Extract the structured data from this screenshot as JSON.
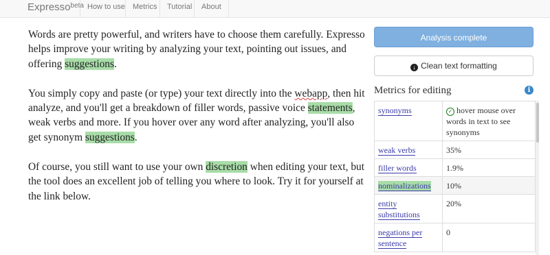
{
  "app": {
    "brand": "Expresso",
    "brand_sup": "beta"
  },
  "nav": {
    "items": [
      "How to use",
      "Metrics",
      "Tutorial",
      "About"
    ]
  },
  "content": {
    "p1": {
      "before": "Words are pretty powerful, and writers have to choose them carefully. Expresso helps improve your writing by analyzing your text, pointing out issues, and offering ",
      "hl": "suggestions",
      "after": "."
    },
    "p2": {
      "a": "You simply copy and paste (or type) your text directly into the ",
      "webapp": "webapp",
      "b": ", then hit analyze, and you'll get a breakdown of filler words, passive voice ",
      "hl1": "statements",
      "c": ", weak verbs and more. If you hover over any word after analyzing, you'll also get synonym ",
      "hl2": "suggestions",
      "d": "."
    },
    "p3": {
      "a": "Of course, you still want to use your own ",
      "hl": "discretion",
      "b": " when editing your text, but the tool does an excellent job of telling you where to look. Try it for yourself at the link below."
    }
  },
  "sidebar": {
    "analysis_button": "Analysis complete",
    "clean_button": "Clean text formatting",
    "metrics_title": "Metrics for editing",
    "metrics": [
      {
        "name": "synonyms",
        "value": "hover mouse over words in text to see synonyms"
      },
      {
        "name": "weak verbs",
        "value": "35%"
      },
      {
        "name": "filler words",
        "value": "1.9%"
      },
      {
        "name": "nominalizations",
        "value": "10%"
      },
      {
        "name": "entity substitutions",
        "value": "20%"
      },
      {
        "name": "negations per sentence",
        "value": "0"
      }
    ]
  },
  "colors": {
    "highlight": "#a8dca8",
    "primary_button": "#7fb0e0",
    "link": "#3a3aa8",
    "info": "#3a87c8"
  }
}
